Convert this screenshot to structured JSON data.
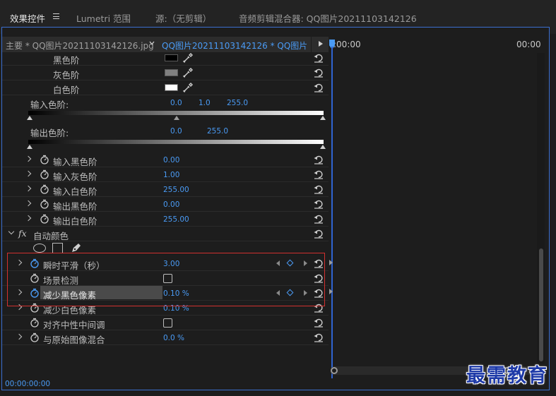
{
  "tabs": [
    {
      "label": "效果控件"
    },
    {
      "label": "Lumetri 范围"
    },
    {
      "label": "源:（无剪辑）"
    },
    {
      "label": "音频剪辑混合器: QQ图片20211103142126"
    }
  ],
  "clip_header": {
    "master_clip": "主要 * QQ图片20211103142126.jpg",
    "sequence_clip": "QQ图片20211103142126  * QQ图片2..."
  },
  "timeline": {
    "start_time": ":00:00",
    "end_time": "00:00",
    "current_time": "00:00:00:00"
  },
  "levels": {
    "black_level": {
      "label": "黑色阶",
      "color": "#000000"
    },
    "gray_level": {
      "label": "灰色阶",
      "color": "#808080"
    },
    "white_level": {
      "label": "白色阶",
      "color": "#ffffff"
    },
    "input_levels": {
      "label": "输入色阶:",
      "v1": "0.0",
      "v2": "1.0",
      "v3": "255.0"
    },
    "output_levels": {
      "label": "输出色阶:",
      "v1": "0.0",
      "v2": "255.0"
    },
    "params": [
      {
        "label": "输入黑色阶",
        "value": "0.00"
      },
      {
        "label": "输入灰色阶",
        "value": "1.00"
      },
      {
        "label": "输入白色阶",
        "value": "255.00"
      },
      {
        "label": "输出黑色阶",
        "value": "0.00"
      },
      {
        "label": "输出白色阶",
        "value": "255.00"
      }
    ]
  },
  "auto_color": {
    "fx": "fx",
    "label": "自动颜色",
    "params": [
      {
        "label": "瞬时平滑（秒）",
        "value": "3.00"
      },
      {
        "label": "场景检测",
        "value": ""
      },
      {
        "label": "减少黑色像素",
        "value": "0.10 %"
      },
      {
        "label": "减少白色像素",
        "value": "0.10 %"
      },
      {
        "label": "对齐中性中间调",
        "value": ""
      },
      {
        "label": "与原始图像混合",
        "value": "0.0 %"
      }
    ]
  },
  "watermark": "最需教育",
  "colors": {
    "accent": "#4a9bf5",
    "highlight": "#d2302e",
    "panel_border": "#3b6fd0"
  }
}
